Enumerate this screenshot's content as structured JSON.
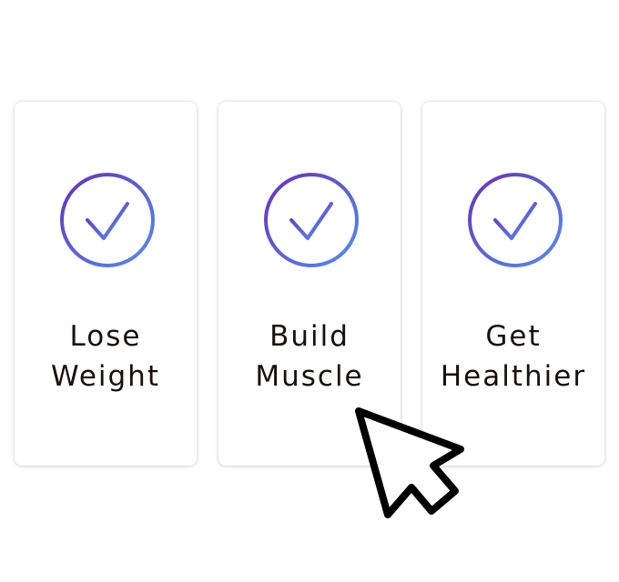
{
  "cards": [
    {
      "line1": "Lose",
      "line2": "Weight",
      "selected": true,
      "icon": "check-circle-icon"
    },
    {
      "line1": "Build",
      "line2": "Muscle",
      "selected": true,
      "icon": "check-circle-icon"
    },
    {
      "line1": "Get",
      "line2": "Healthier",
      "selected": true,
      "icon": "check-circle-icon"
    }
  ],
  "colors": {
    "gradient_start": "#6a2fc0",
    "gradient_end": "#4f8ff0",
    "text": "#1a0f0f",
    "card_bg": "#ffffff"
  },
  "cursor": {
    "icon": "arrow-pointer-icon"
  }
}
